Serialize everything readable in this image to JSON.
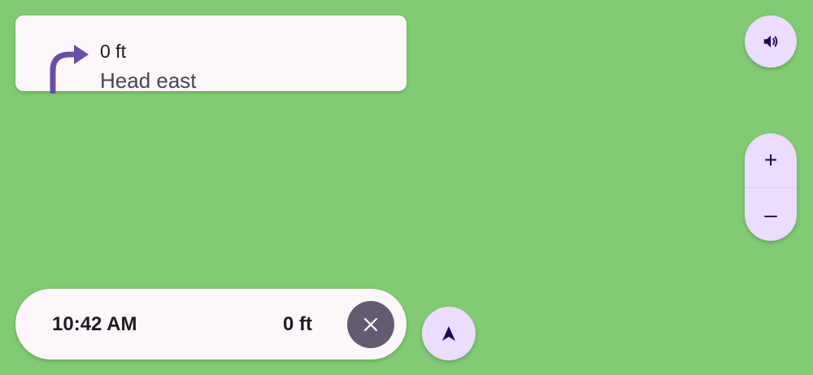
{
  "instruction": {
    "distance": "0 ft",
    "street": "Head east",
    "maneuver_icon": "turn-right-icon"
  },
  "controls": {
    "sound_icon": "volume-icon",
    "zoom_in_label": "+",
    "zoom_out_label": "–",
    "recenter_icon": "navigation-arrow-icon"
  },
  "trip": {
    "eta": "10:42 AM",
    "remaining_distance": "0 ft",
    "close_icon": "close-icon"
  },
  "colors": {
    "map_background": "#82ca73",
    "card_background": "#fdf7fc",
    "button_background": "#eaddff",
    "maneuver_arrow": "#6750a4",
    "close_button": "#625b71"
  }
}
